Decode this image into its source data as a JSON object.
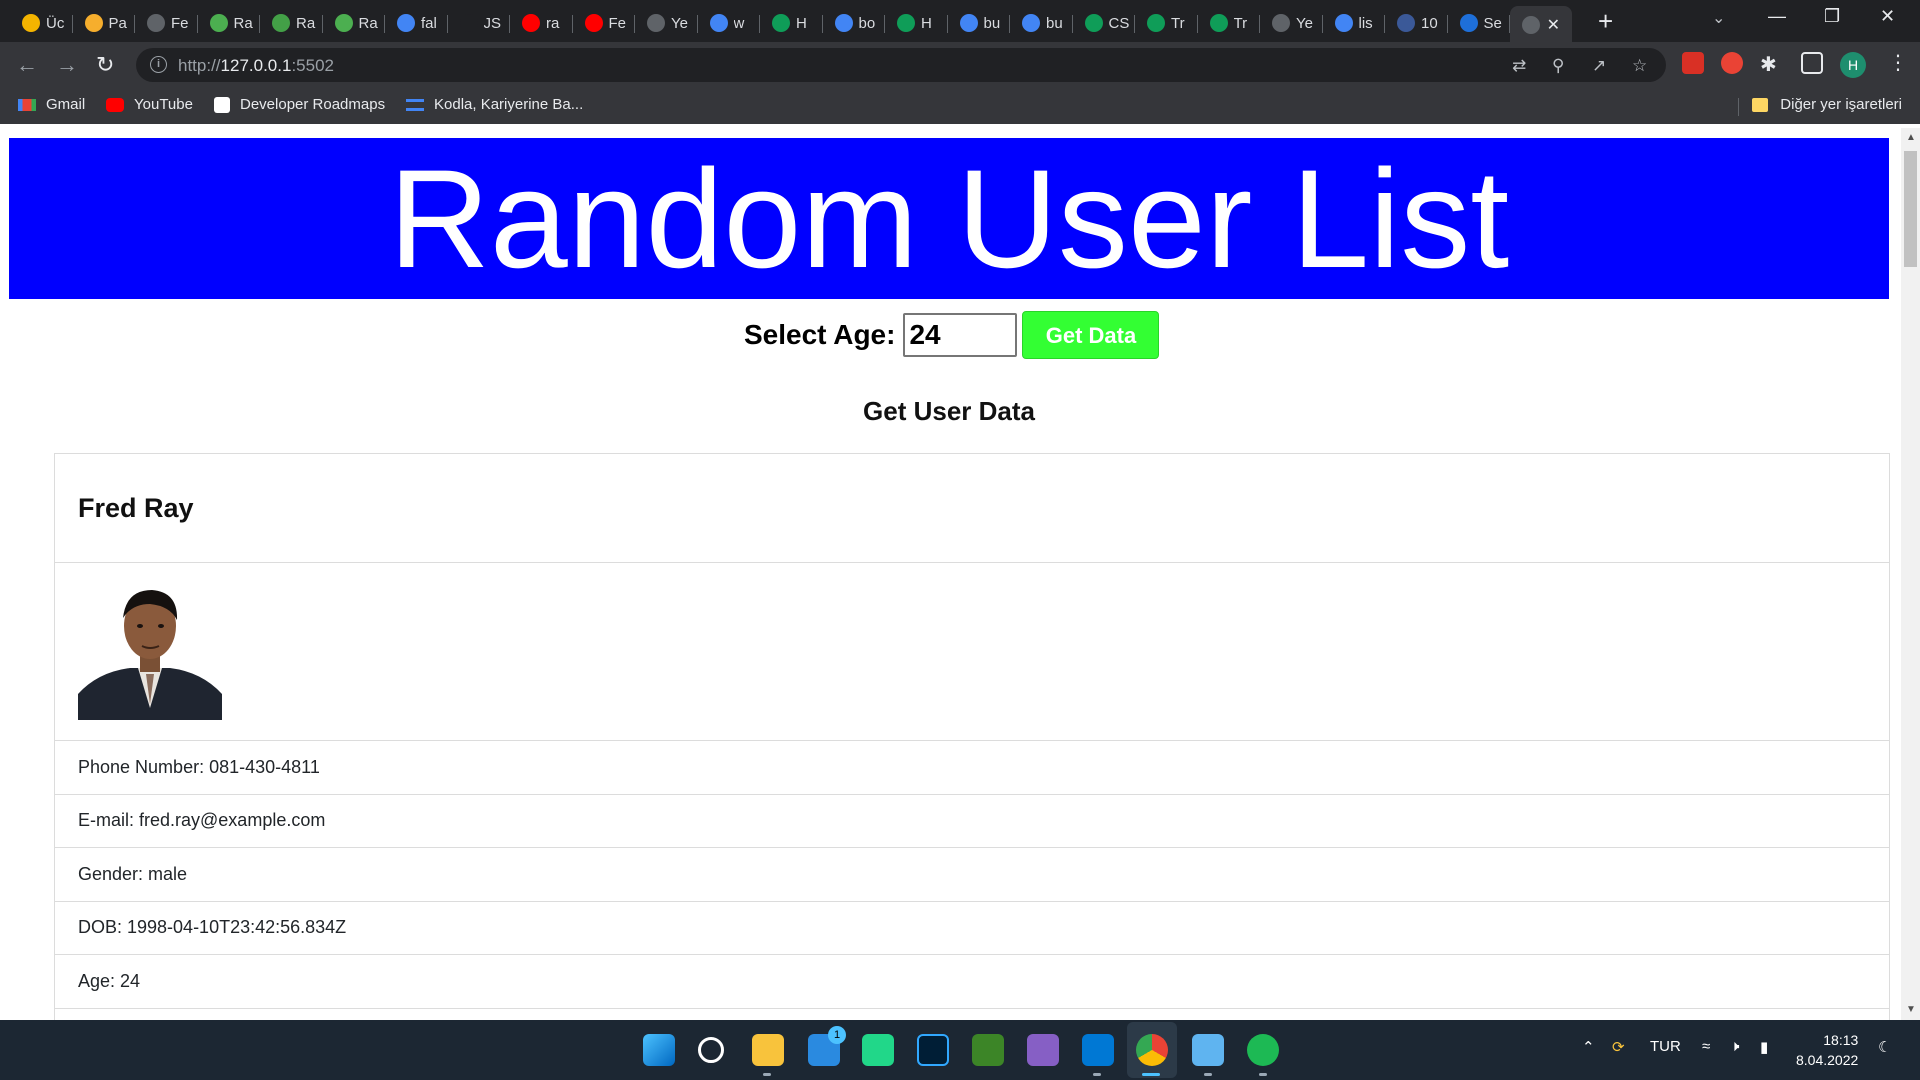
{
  "browser": {
    "tabs": [
      {
        "title": "Üc",
        "color": "#f4b400"
      },
      {
        "title": "Pa",
        "color": "#f6ae2d"
      },
      {
        "title": "Fe",
        "color": "#5f6368"
      },
      {
        "title": "Ra",
        "color": "#4caf50"
      },
      {
        "title": "Ra",
        "color": "#43a047"
      },
      {
        "title": "Ra",
        "color": "#4caf50"
      },
      {
        "title": "fal",
        "color": "#4285f4"
      },
      {
        "title": "JS",
        "color": "#202124"
      },
      {
        "title": "ra",
        "color": "#ff0000"
      },
      {
        "title": "Fe",
        "color": "#ff0000"
      },
      {
        "title": "Ye",
        "color": "#5f6368"
      },
      {
        "title": "w",
        "color": "#4285f4"
      },
      {
        "title": "H",
        "color": "#0f9d58"
      },
      {
        "title": "bo",
        "color": "#4285f4"
      },
      {
        "title": "H",
        "color": "#0f9d58"
      },
      {
        "title": "bu",
        "color": "#4285f4"
      },
      {
        "title": "bu",
        "color": "#4285f4"
      },
      {
        "title": "CS",
        "color": "#0f9d58"
      },
      {
        "title": "Tr",
        "color": "#0f9d58"
      },
      {
        "title": "Tr",
        "color": "#0f9d58"
      },
      {
        "title": "Ye",
        "color": "#5f6368"
      },
      {
        "title": "lis",
        "color": "#4285f4"
      },
      {
        "title": "10",
        "color": "#3b5998"
      },
      {
        "title": "Se",
        "color": "#1e6fd9"
      }
    ],
    "active_tab_title": "",
    "url_prefix": "http://",
    "url_host": "127.0.0.1",
    "url_port": ":5502",
    "profile_initial": "H",
    "bookmarks": [
      {
        "label": "Gmail",
        "color": "#ea4335"
      },
      {
        "label": "YouTube",
        "color": "#ff0000"
      },
      {
        "label": "Developer Roadmaps",
        "color": "#ffffff"
      },
      {
        "label": "Kodla, Kariyerine Ba...",
        "color": "#4285f4"
      }
    ],
    "other_bookmarks": "Diğer yer işaretleri"
  },
  "page": {
    "banner_title": "Random User List",
    "age_label": "Select Age:",
    "age_value": "24",
    "get_data_button": "Get Data",
    "subtitle": "Get User Data",
    "user": {
      "name": "Fred Ray",
      "phone": "Phone Number: 081-430-4811",
      "email": "E-mail: fred.ray@example.com",
      "gender": "Gender: male",
      "dob": "DOB: 1998-04-10T23:42:56.834Z",
      "age": "Age: 24"
    },
    "colors": {
      "banner": "#0000ff",
      "button": "#33ff33"
    }
  },
  "taskbar": {
    "mail_badge": "1",
    "language": "TUR",
    "time": "18:13",
    "date": "8.04.2022"
  }
}
